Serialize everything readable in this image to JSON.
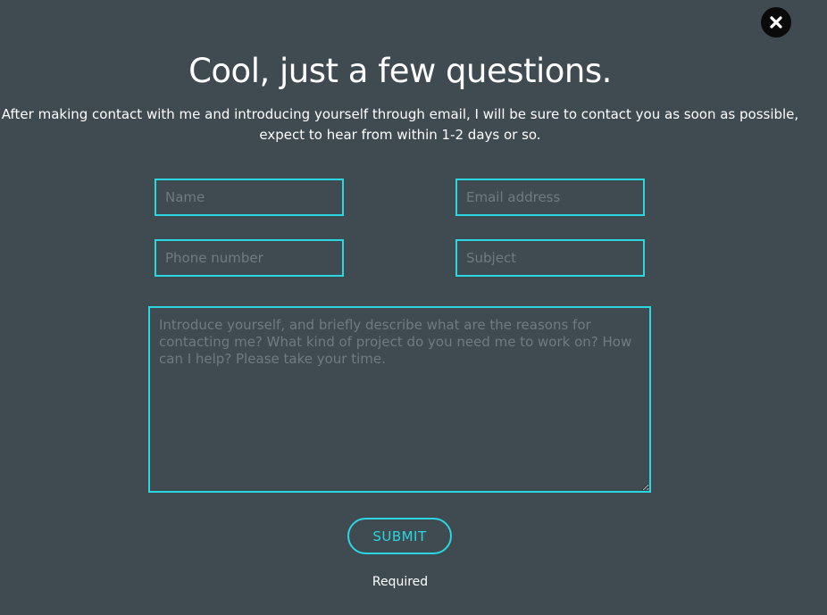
{
  "close": {
    "icon": "close-icon"
  },
  "header": {
    "title": "Cool, just a few questions.",
    "intro": "After making contact with me and introducing yourself through email, I will be sure to contact you as soon as possible, expect to hear from within 1-2 days or so."
  },
  "form": {
    "name": {
      "placeholder": "Name",
      "value": ""
    },
    "email": {
      "placeholder": "Email address",
      "value": ""
    },
    "phone": {
      "placeholder": "Phone number",
      "value": ""
    },
    "subject": {
      "placeholder": "Subject",
      "value": ""
    },
    "message": {
      "placeholder": "Introduce yourself, and briefly describe what are the reasons for contacting me? What kind of project do you need me to work on? How can I help? Please take your time.",
      "value": ""
    },
    "submit_label": "SUBMIT",
    "required_text": "Required"
  },
  "colors": {
    "background": "#404b51",
    "accent": "#2ad6e0",
    "text": "#ffffff"
  }
}
